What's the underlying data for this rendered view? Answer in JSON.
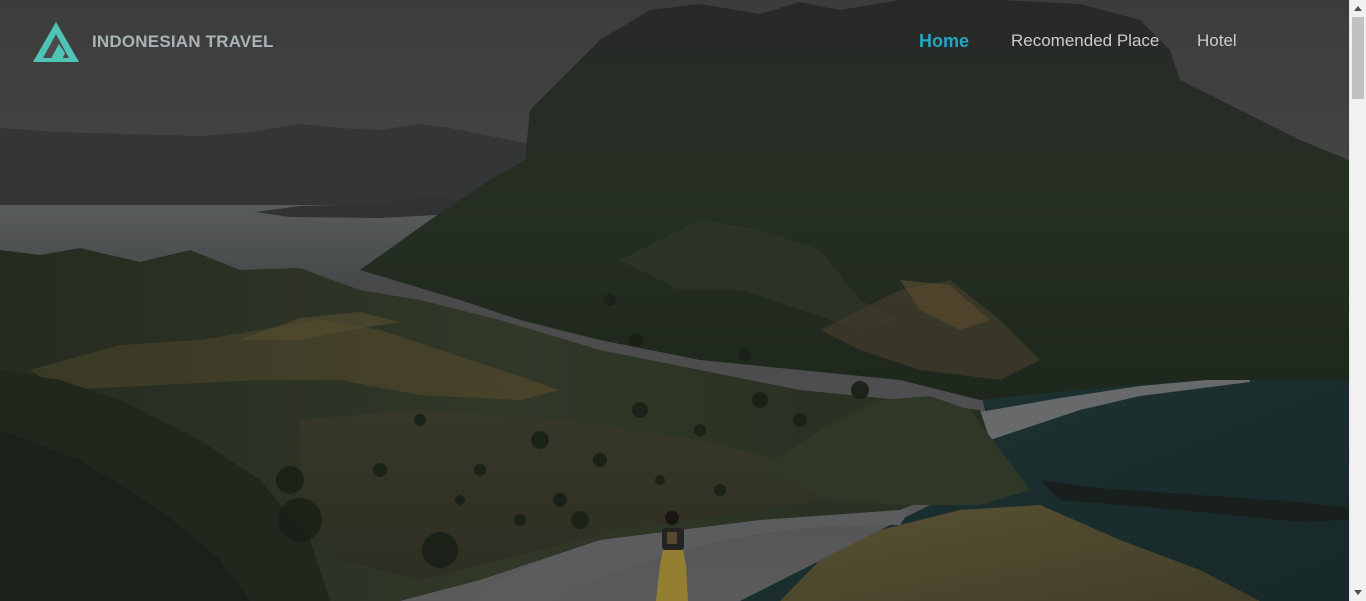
{
  "brand": {
    "name": "INDONESIAN TRAVEL",
    "logo_icon": "triangle-a-logo-icon",
    "logo_color": "#4fc3b5"
  },
  "nav": {
    "items": [
      {
        "label": "Home",
        "active": true
      },
      {
        "label": "Recomended Place",
        "active": false
      },
      {
        "label": "Hotel",
        "active": false
      }
    ],
    "active_color": "#23a6c4",
    "link_color": "#c9cccb"
  },
  "hero": {
    "image_alt": "Padar Island landscape at dusk with a traveler on a ridge"
  },
  "scrollbar": {
    "up_icon": "scroll-up-arrow-icon",
    "down_icon": "scroll-down-arrow-icon"
  }
}
